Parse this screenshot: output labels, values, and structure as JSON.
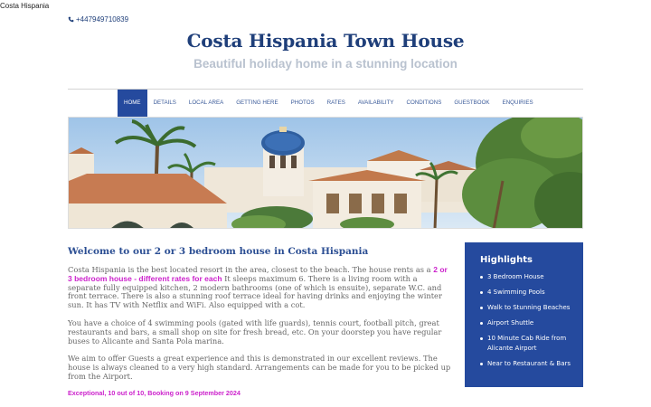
{
  "browser": {
    "tab_title": "Costa Hispania"
  },
  "header": {
    "phone": "+447949710839",
    "title": "Costa Hispania Town House",
    "subtitle": "Beautiful holiday home in a stunning location"
  },
  "nav": {
    "items": [
      "HOME",
      "DETAILS",
      "LOCAL AREA",
      "GETTING HERE",
      "PHOTOS",
      "RATES",
      "AVAILABILITY",
      "CONDITIONS",
      "GUESTBOOK",
      "ENQUIRIES"
    ],
    "active": "HOME"
  },
  "main": {
    "heading": "Welcome to our 2 or 3 bedroom house in Costa Hispania",
    "p1_start": "Costa Hispania is the best located resort in the area, closest to the beach. The house rents as a ",
    "p1_highlight": "2 or 3 bedroom house - different rates for each",
    "p1_end": "  It sleeps maximum 6.  There is a living room with a separate fully equipped kitchen,  2 modern bathrooms (one of which is ensuite), separate W.C. and front terrace.  There is also a stunning roof terrace ideal for having drinks and enjoying the winter sun.  It has TV with Netflix and WiFi. Also equipped with a cot.",
    "p2": "You have a choice of 4 swimming pools (gated with life guards), tennis court, football pitch, great restaurants and bars, a small shop on site for fresh bread, etc. On your doorstep you have regular buses to Alicante and Santa Pola marina.",
    "p3": "We aim to offer Guests a great experience and this is demonstrated in our excellent reviews. The house is always cleaned to a very high standard. Arrangements can be made for you to be picked up from the Airport.",
    "review": "Exceptional, 10 out of 10, Booking on 9 September 2024"
  },
  "sidebar": {
    "title": "Highlights",
    "items": [
      "3 Bedroom House",
      "4 Swimming Pools",
      "Walk to Stunning Beaches",
      "Airport Shuttle",
      "10 Minute Cab Ride from Alicante Airport",
      "Near to Restaurant & Bars"
    ]
  },
  "colors": {
    "brand_blue": "#254a9e",
    "title_blue": "#1f3f7a",
    "highlight_magenta": "#cc22cc",
    "subtitle_grey": "#b9c2cf"
  }
}
